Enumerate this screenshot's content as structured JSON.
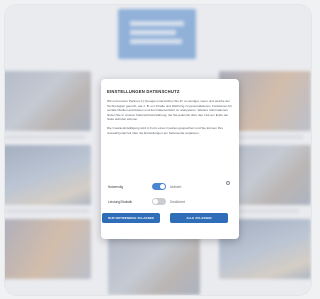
{
  "background": {
    "header_lines": 3,
    "accent": "#2f73c6"
  },
  "dialog": {
    "title": "EINSTELLUNGEN DATENSCHUTZ",
    "paragraph_1": "Wir und unsere Partner(-1) (Google unterstützen Sie ihr so weniger, wenn und welche der Technologien genutzt, wie z. B. um Inhalte und Werbung zu personalisieren, Funktionen für soziale Medien anzubieten und den Datenverkehr zu analysieren. Weitere Informationen finden Sie in unserer Datenschutzerklärung, die Sie jederzeit über den Link am Ende der Seite aufrufen können.",
    "paragraph_2": "Die Cookie-Einwilligung wird in Form eines Cookies gespeichert und Sie können Ihre Auswahl jederzeit über die Einstellungen am Seitenende anpassen.",
    "toggles": [
      {
        "label": "Notwendig",
        "state": "Aktiviert",
        "on": true
      },
      {
        "label": "Leistung/Statistik",
        "state": "Deaktiviert",
        "on": false
      }
    ],
    "reject_button": "NUR NOTWENDIGE ZULASSEN",
    "accept_button": "ALLE ZULASSEN",
    "info_icon": "info-icon"
  }
}
